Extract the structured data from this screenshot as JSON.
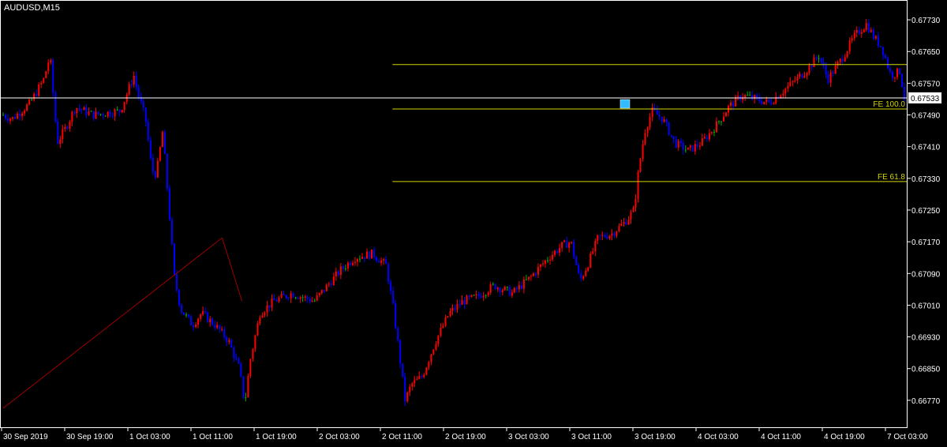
{
  "chart_data": {
    "type": "candlestick",
    "symbol_label": "AUDUSD,M15",
    "colors": {
      "background": "#000000",
      "frame": "#ffffff",
      "text": "#ffffff",
      "bull": "#ff0000",
      "bear": "#0000ff",
      "doji": "#00b300",
      "fibo": "#d4d400",
      "trendline": "#a00000",
      "price_line": "#ffffff",
      "marker": "#33bbff"
    },
    "y_axis": {
      "range": [
        0.667,
        0.6778
      ],
      "ticks": [
        "0.67730",
        "0.67650",
        "0.67570",
        "0.67490",
        "0.67410",
        "0.67330",
        "0.67250",
        "0.67170",
        "0.67090",
        "0.67010",
        "0.66930",
        "0.66850",
        "0.66770"
      ]
    },
    "x_axis": {
      "ticks": [
        "30 Sep 2019",
        "30 Sep 19:00",
        "1 Oct 03:00",
        "1 Oct 11:00",
        "1 Oct 19:00",
        "2 Oct 03:00",
        "2 Oct 11:00",
        "2 Oct 19:00",
        "3 Oct 03:00",
        "3 Oct 11:00",
        "3 Oct 19:00",
        "4 Oct 03:00",
        "4 Oct 11:00",
        "4 Oct 19:00",
        "7 Oct 03:00"
      ]
    },
    "current_price": "0.67533",
    "fibo_levels": [
      {
        "price": 0.67617,
        "label": ""
      },
      {
        "price": 0.67505,
        "label": "FE 100.0"
      },
      {
        "price": 0.67322,
        "label": "FE 61.8"
      }
    ],
    "trendlines": [
      {
        "points": [
          [
            0.0,
            0.6675
          ],
          [
            0.243,
            0.6718
          ]
        ]
      },
      {
        "points": [
          [
            0.243,
            0.6718
          ],
          [
            0.265,
            0.6702
          ]
        ]
      }
    ],
    "close_path": [
      [
        0.0,
        0.6749
      ],
      [
        0.01,
        0.6748
      ],
      [
        0.03,
        0.6752
      ],
      [
        0.045,
        0.6758
      ],
      [
        0.052,
        0.6764
      ],
      [
        0.06,
        0.6742
      ],
      [
        0.07,
        0.6746
      ],
      [
        0.08,
        0.6751
      ],
      [
        0.1,
        0.6749
      ],
      [
        0.13,
        0.675
      ],
      [
        0.145,
        0.6759
      ],
      [
        0.15,
        0.6754
      ],
      [
        0.158,
        0.6748
      ],
      [
        0.165,
        0.6735
      ],
      [
        0.17,
        0.6734
      ],
      [
        0.177,
        0.6745
      ],
      [
        0.183,
        0.6728
      ],
      [
        0.19,
        0.6708
      ],
      [
        0.197,
        0.67
      ],
      [
        0.21,
        0.6696
      ],
      [
        0.22,
        0.6699
      ],
      [
        0.235,
        0.6696
      ],
      [
        0.25,
        0.6692
      ],
      [
        0.262,
        0.6685
      ],
      [
        0.268,
        0.6676
      ],
      [
        0.274,
        0.6687
      ],
      [
        0.285,
        0.6699
      ],
      [
        0.3,
        0.6702
      ],
      [
        0.32,
        0.6704
      ],
      [
        0.345,
        0.6702
      ],
      [
        0.36,
        0.6706
      ],
      [
        0.375,
        0.671
      ],
      [
        0.39,
        0.6713
      ],
      [
        0.41,
        0.6714
      ],
      [
        0.425,
        0.6711
      ],
      [
        0.433,
        0.67
      ],
      [
        0.44,
        0.6688
      ],
      [
        0.446,
        0.6677
      ],
      [
        0.453,
        0.6681
      ],
      [
        0.465,
        0.6683
      ],
      [
        0.48,
        0.6692
      ],
      [
        0.495,
        0.6699
      ],
      [
        0.51,
        0.6702
      ],
      [
        0.525,
        0.6703
      ],
      [
        0.545,
        0.6706
      ],
      [
        0.565,
        0.6704
      ],
      [
        0.585,
        0.6708
      ],
      [
        0.605,
        0.6713
      ],
      [
        0.62,
        0.6716
      ],
      [
        0.63,
        0.6717
      ],
      [
        0.64,
        0.6707
      ],
      [
        0.65,
        0.6712
      ],
      [
        0.66,
        0.6718
      ],
      [
        0.675,
        0.6719
      ],
      [
        0.69,
        0.6722
      ],
      [
        0.7,
        0.6725
      ],
      [
        0.705,
        0.6735
      ],
      [
        0.712,
        0.6745
      ],
      [
        0.72,
        0.675
      ],
      [
        0.732,
        0.6748
      ],
      [
        0.745,
        0.6742
      ],
      [
        0.76,
        0.674
      ],
      [
        0.775,
        0.6742
      ],
      [
        0.79,
        0.6746
      ],
      [
        0.805,
        0.6751
      ],
      [
        0.82,
        0.6754
      ],
      [
        0.835,
        0.6753
      ],
      [
        0.85,
        0.6752
      ],
      [
        0.87,
        0.6756
      ],
      [
        0.89,
        0.676
      ],
      [
        0.905,
        0.6764
      ],
      [
        0.915,
        0.6758
      ],
      [
        0.93,
        0.6763
      ],
      [
        0.945,
        0.6769
      ],
      [
        0.958,
        0.6772
      ],
      [
        0.965,
        0.6769
      ],
      [
        0.975,
        0.6766
      ],
      [
        0.985,
        0.6759
      ],
      [
        0.995,
        0.676
      ],
      [
        1.0,
        0.67533
      ]
    ]
  }
}
